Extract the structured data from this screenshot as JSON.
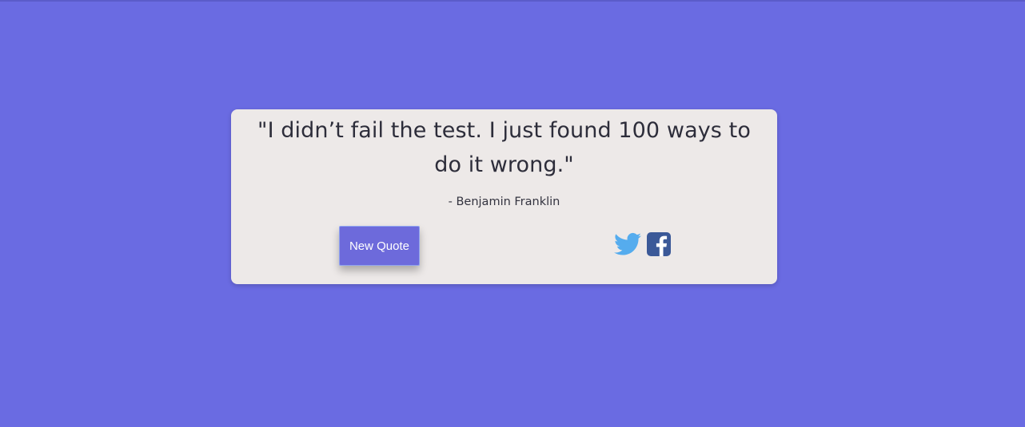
{
  "quote": {
    "text": "\"I didn’t fail the test. I just found 100 ways to do it wrong.\"",
    "author": "- Benjamin Franklin"
  },
  "actions": {
    "new_quote_label": "New Quote",
    "icons": [
      "twitter-icon",
      "facebook-icon"
    ]
  },
  "colors": {
    "background": "#6a6be2",
    "card": "#ede9e8",
    "button": "#6d6adb",
    "twitter": "#55acee",
    "facebook": "#3b5998"
  }
}
